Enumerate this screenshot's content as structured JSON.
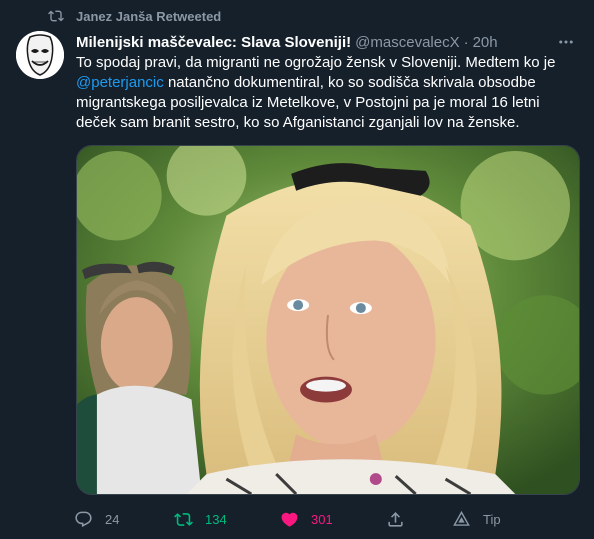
{
  "retweet_banner": {
    "text": "Janez Janša Retweeted",
    "icon": "retweet-icon"
  },
  "tweet": {
    "author_name": "Milenijski maščevalec: Slava Sloveniji!",
    "author_handle": "@mascevalecX",
    "separator": "·",
    "time": "20h",
    "text_part1": "To spodaj pravi, da migranti ne ogrožajo žensk v Sloveniji. Medtem ko je ",
    "mention": "@peterjancic",
    "text_part2": " natančno dokumentiral, ko so sodišča skrivala obsodbe migrantskega posiljevalca iz Metelkove, v Postojni pa je moral 16 letni deček sam branit sestro, ko so Afganistanci zganjali lov na ženske."
  },
  "actions": {
    "reply_count": "24",
    "retweet_count": "134",
    "like_count": "301",
    "tip_label": "Tip"
  },
  "colors": {
    "background": "#15202b",
    "text": "#ffffff",
    "muted": "#8b98a5",
    "link": "#1d9bf0",
    "retweet_active": "#00ba7c",
    "like_active": "#f91880"
  }
}
